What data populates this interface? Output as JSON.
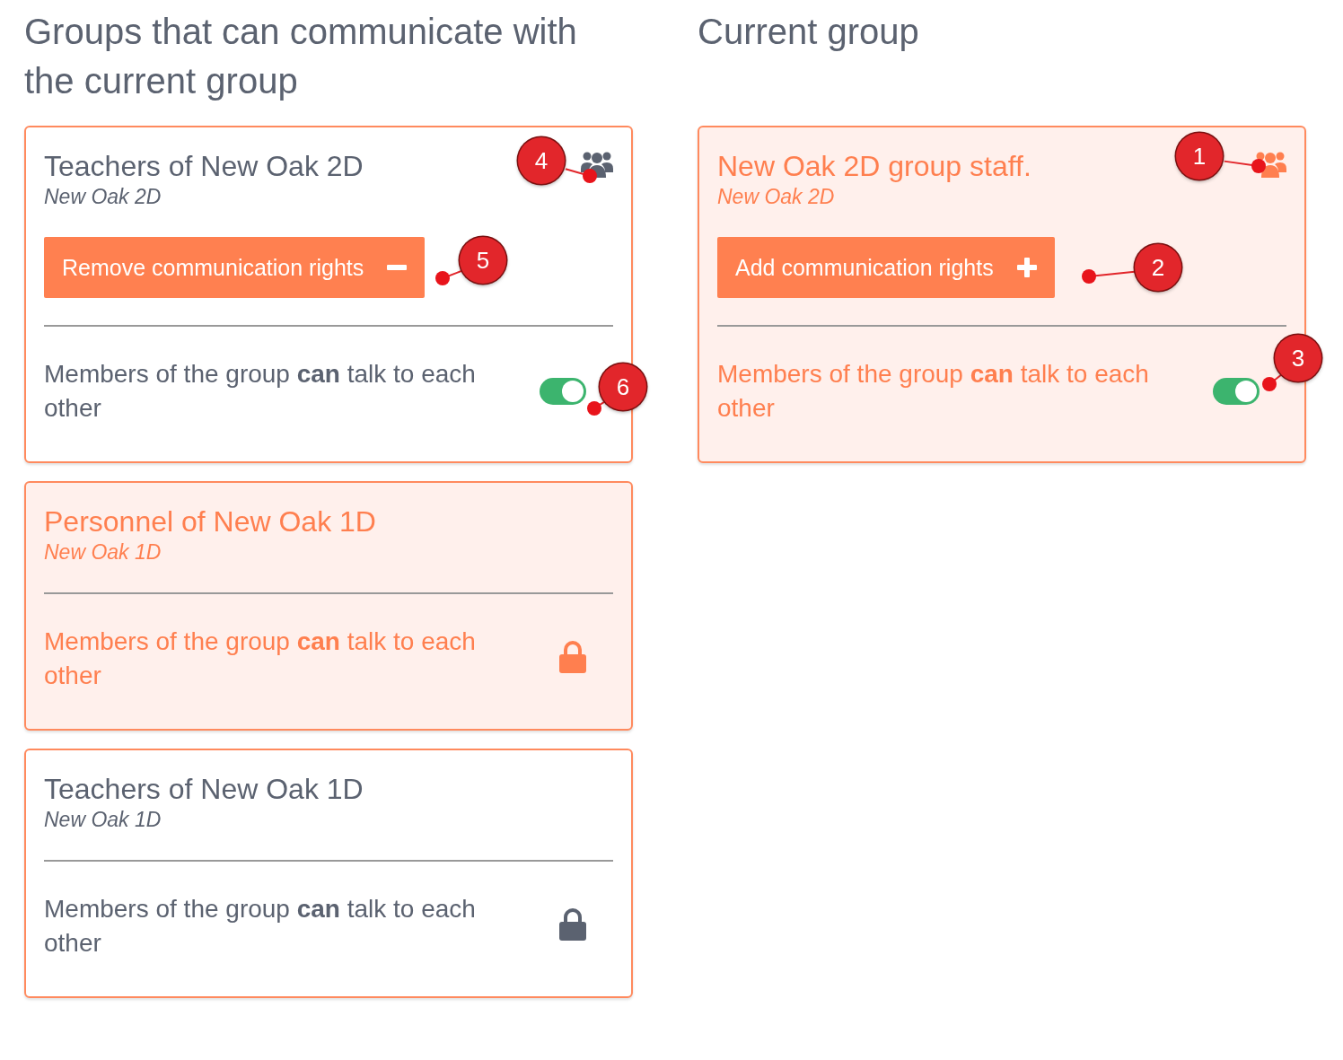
{
  "columns": [
    {
      "heading": "Groups that can communicate with the current group",
      "cards": [
        {
          "title": "Teachers of New Oak 2D",
          "subtitle": "New Oak 2D",
          "highlighted": false,
          "group_icon": true,
          "button": {
            "kind": "remove",
            "label": "Remove communication rights"
          },
          "text": "Members of the group **can** talk to each other",
          "control": {
            "kind": "toggle",
            "on": true
          },
          "callouts": [
            "4",
            "5",
            "6"
          ]
        },
        {
          "title": "Personnel of New Oak 1D",
          "subtitle": "New Oak 1D",
          "highlighted": true,
          "text": "Members of the group **can** talk to each other",
          "control": {
            "kind": "lock"
          }
        },
        {
          "title": "Teachers of New Oak 1D",
          "subtitle": "New Oak 1D",
          "highlighted": false,
          "text": "Members of the group **can** talk to each other",
          "control": {
            "kind": "lock"
          }
        }
      ]
    },
    {
      "heading": "Current group",
      "cards": [
        {
          "title": "New Oak 2D group staff.",
          "subtitle": "New Oak 2D",
          "highlighted": true,
          "group_icon": true,
          "button": {
            "kind": "add",
            "label": "Add communication rights"
          },
          "text": "Members of the group **can** talk to each other",
          "control": {
            "kind": "toggle",
            "on": true
          },
          "callouts": [
            "1",
            "2",
            "3"
          ]
        }
      ]
    }
  ]
}
